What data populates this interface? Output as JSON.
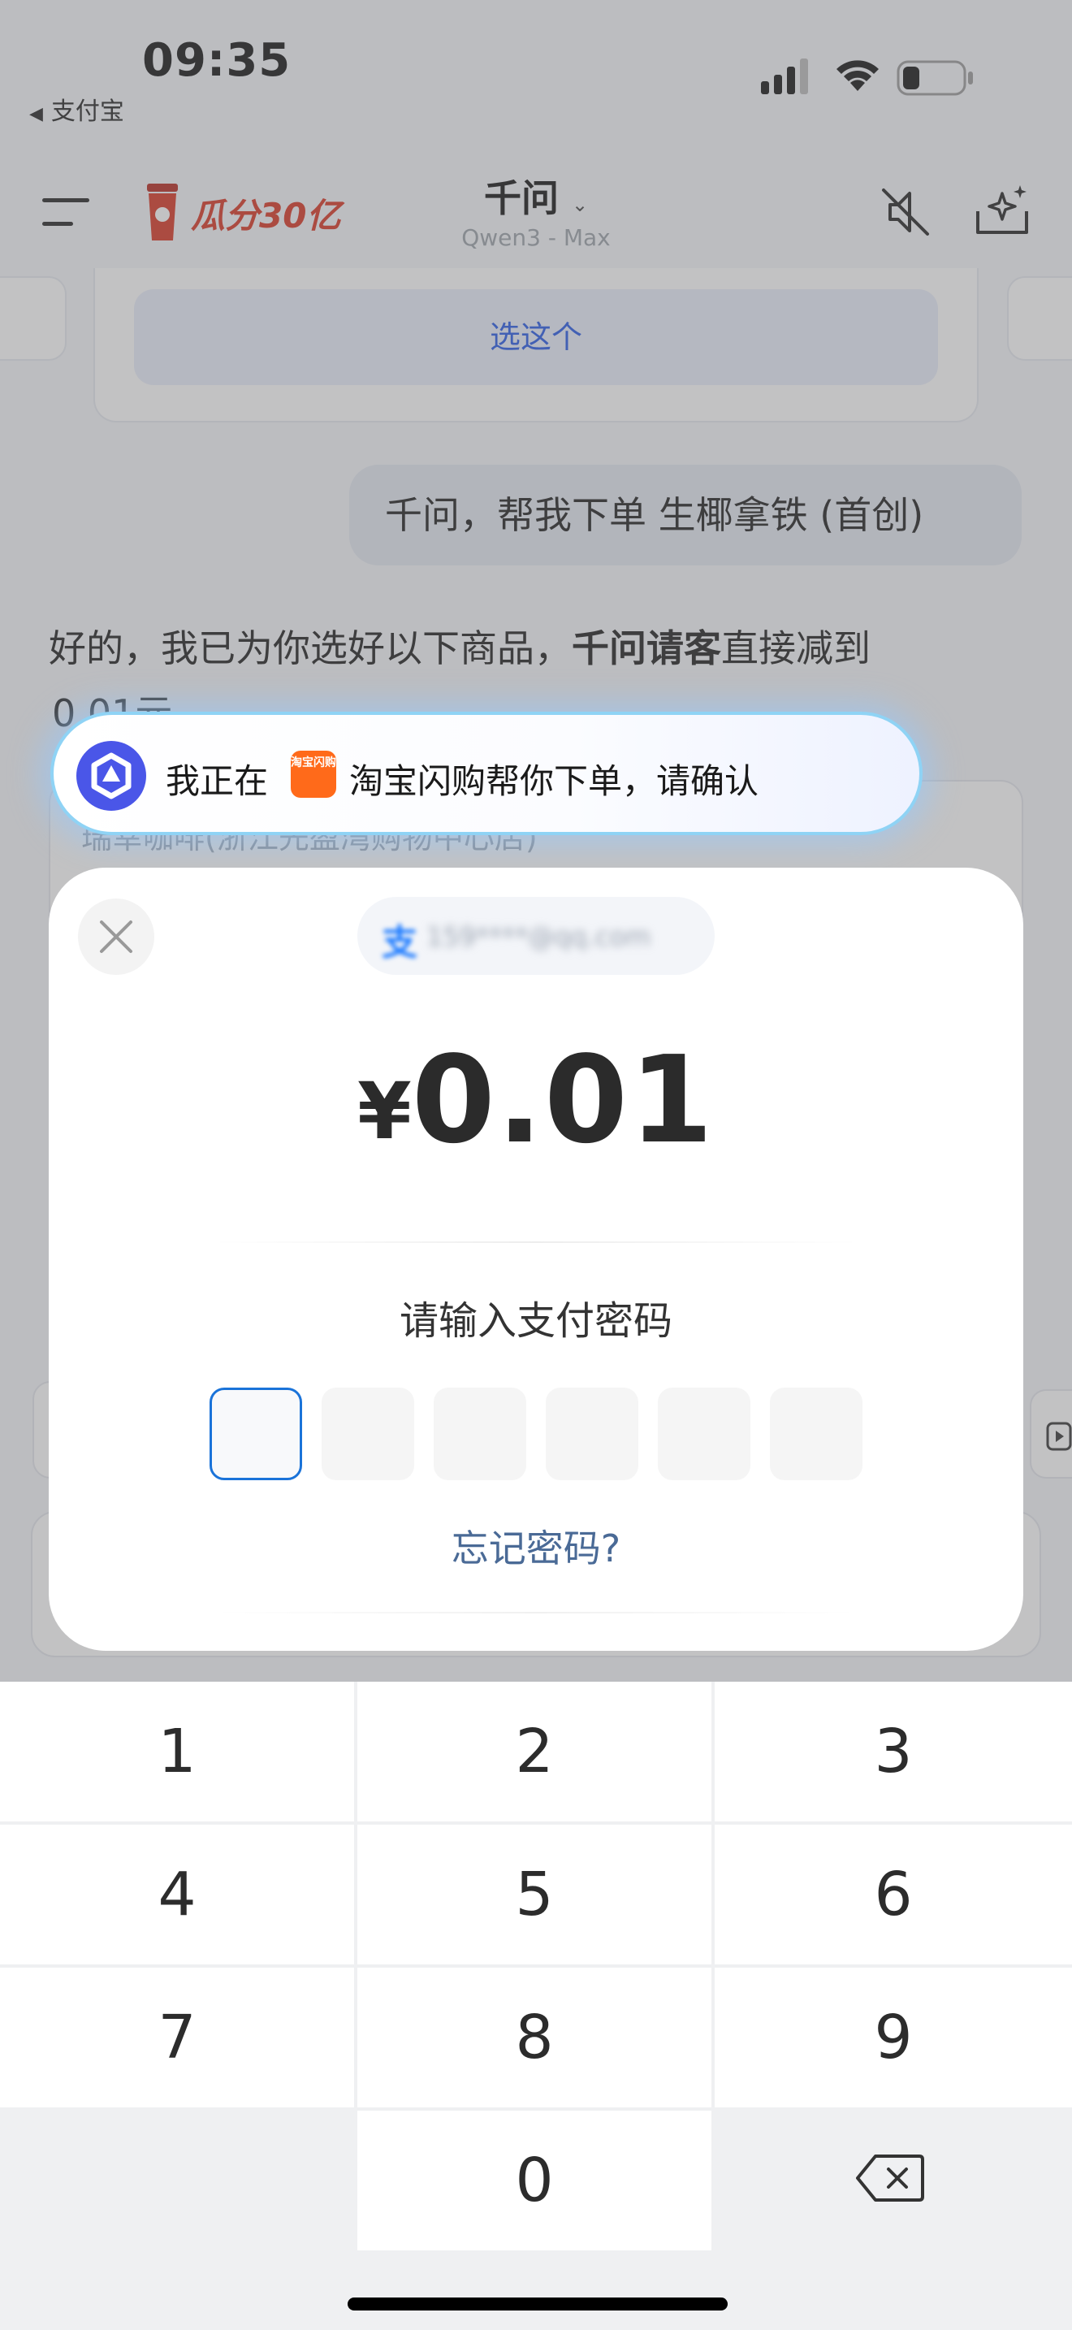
{
  "status_bar": {
    "time": "09:35",
    "back_app": "支付宝"
  },
  "nav": {
    "promo_text": "瓜分30亿",
    "title": "千问",
    "subtitle": "Qwen3 - Max"
  },
  "chat": {
    "select_button": "选这个",
    "user_message": "千问，帮我下单 生椰拿铁 (首创)",
    "reply_prefix": "好的，我已为你选好以下商品，",
    "reply_bold": "千问请客",
    "reply_suffix": "直接减到",
    "reply_line2": "0.01元",
    "faded_card_text": "瑞幸咖啡(浙江先盈湾购物中心店)"
  },
  "agent_banner": {
    "text_before": "我正在",
    "app_logo": "淘宝闪购",
    "text_after": "淘宝闪购帮你下单，请确认"
  },
  "payment": {
    "account": "159****@qq.com",
    "currency": "¥",
    "amount": "0.01",
    "password_prompt": "请输入支付密码",
    "password_digits_entered": 0,
    "password_length": 6,
    "forgot_link": "忘记密码?"
  },
  "keypad": {
    "keys": [
      "1",
      "2",
      "3",
      "4",
      "5",
      "6",
      "7",
      "8",
      "9",
      "",
      "0",
      "backspace"
    ]
  },
  "colors": {
    "accent_blue": "#1a73d9",
    "link_blue": "#4a6a96",
    "agent_logo": "#4a56e8",
    "taobao_orange": "#ff6a1a"
  }
}
